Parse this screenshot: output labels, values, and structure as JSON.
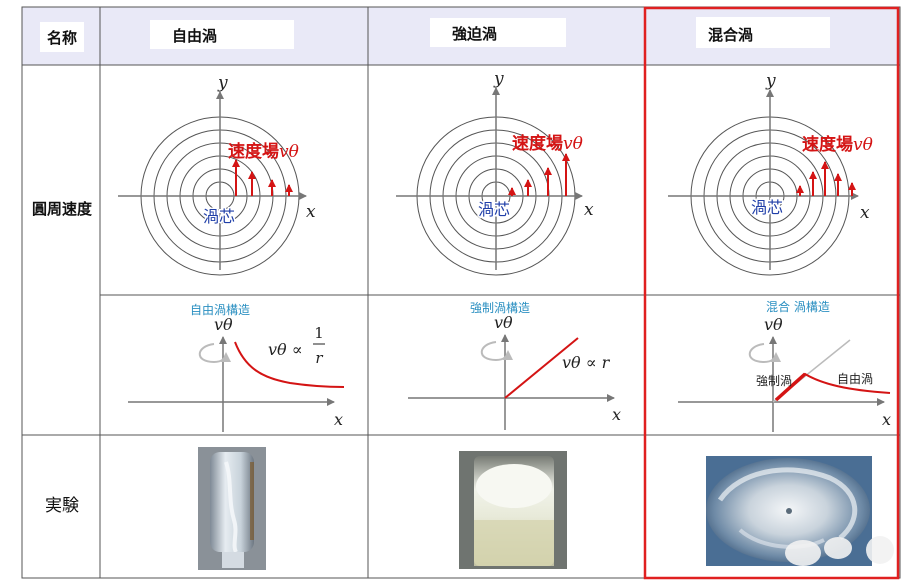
{
  "header": {
    "name_label": "名称",
    "col1": "自由渦",
    "col2": "強迫渦",
    "col3": "混合渦"
  },
  "rows": {
    "velocity": "圓周速度",
    "experiment": "実験"
  },
  "polar": {
    "y_label": "y",
    "x_label": "x",
    "core_label": "渦芯",
    "field_label": "速度場",
    "field_symbol": "vθ"
  },
  "profiles": {
    "free": {
      "title": "自由渦構造",
      "v_label": "vθ",
      "x_label": "x",
      "formula_left": "vθ ∝",
      "formula_num": "1",
      "formula_den": "r"
    },
    "forced": {
      "title": "強制渦構造",
      "v_label": "vθ",
      "x_label": "x",
      "formula": "vθ ∝ r"
    },
    "combined": {
      "title": "混合 渦構造",
      "v_label": "vθ",
      "x_label": "x",
      "forced_label": "強制渦",
      "free_label": "自由渦"
    }
  },
  "colors": {
    "header_bg": "#e9e9f7",
    "accent_red": "#d41414",
    "axis": "#777777",
    "circle": "#555555",
    "core_text": "#1f3ea8",
    "title_blue": "#2a8fc1",
    "highlight_border": "#e02020"
  },
  "icons": {
    "rotation": "rotation-arrow-icon"
  }
}
